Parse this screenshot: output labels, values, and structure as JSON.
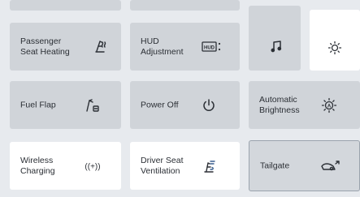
{
  "tiles": {
    "passenger_seat_heating": {
      "label": "Passenger\nSeat Heating",
      "icon": "seat-heating-icon"
    },
    "hud_adjustment": {
      "label": "HUD\nAdjustment",
      "icon": "hud-icon",
      "icon_text": "HUD"
    },
    "media": {
      "icon": "music-note-icon"
    },
    "brightness_top": {
      "icon": "brightness-icon"
    },
    "fuel_flap": {
      "label": "Fuel Flap",
      "icon": "fuel-flap-icon"
    },
    "power_off": {
      "label": "Power Off",
      "icon": "power-icon"
    },
    "automatic_brightness": {
      "label": "Automatic\nBrightness",
      "icon": "auto-brightness-icon"
    },
    "wireless_charging": {
      "label": "Wireless\nCharging",
      "icon": "wireless-charging-icon",
      "icon_text": "((+))"
    },
    "driver_seat_ventilation": {
      "label": "Driver Seat\nVentilation",
      "icon": "seat-ventilation-icon"
    },
    "tailgate": {
      "label": "Tailgate",
      "icon": "tailgate-icon"
    }
  },
  "colors": {
    "tile_default": "#d0d4d9",
    "tile_light": "#ffffff",
    "tile_active_border": "#9aa3ad",
    "background": "#e7eaee",
    "text": "#2b2f35"
  }
}
